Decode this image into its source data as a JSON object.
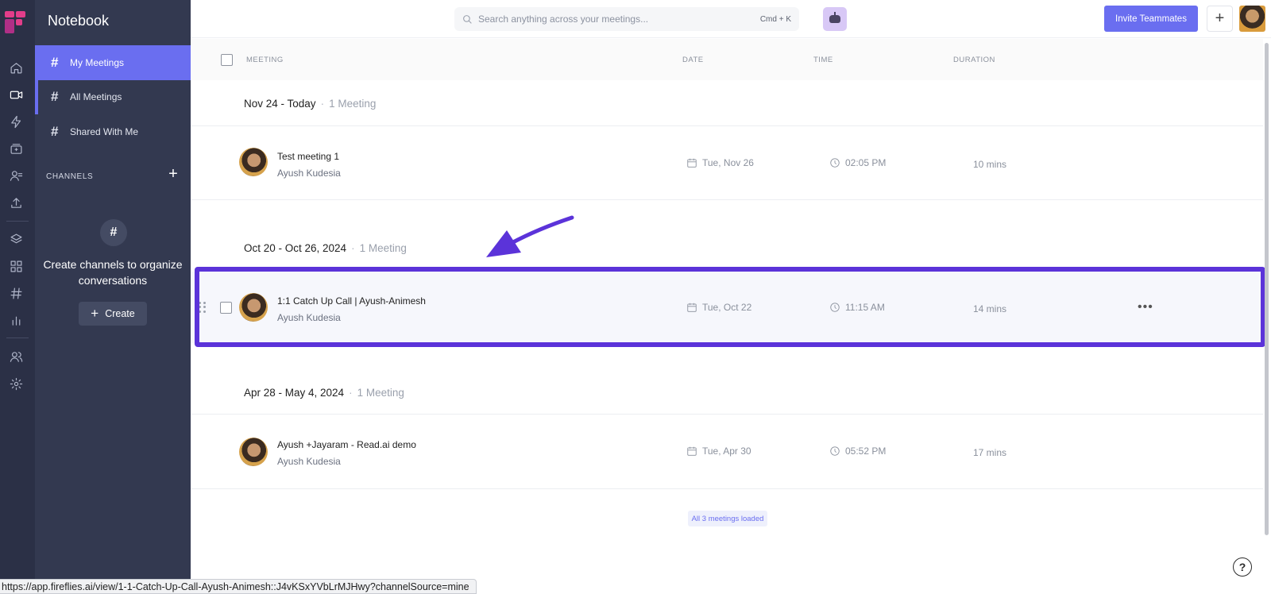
{
  "app": {
    "name": "Notebook",
    "brand_color": "#6a6ef0",
    "rail_icons": [
      "home-icon",
      "video-icon",
      "bolt-icon",
      "inbox-icon",
      "contacts-icon",
      "upload-icon",
      "layers-icon",
      "apps-grid-icon",
      "hash-icon",
      "analytics-icon",
      "team-icon",
      "settings-icon"
    ]
  },
  "sidebar": {
    "items": [
      {
        "label": "My Meetings"
      },
      {
        "label": "All Meetings"
      },
      {
        "label": "Shared With Me"
      }
    ],
    "channels_label": "CHANNELS",
    "channels_empty_text": "Create channels to organize conversations",
    "create_label": "Create"
  },
  "topbar": {
    "search_placeholder": "Search anything across your meetings...",
    "shortcut": "Cmd + K",
    "invite_label": "Invite Teammates"
  },
  "table": {
    "columns": [
      "MEETING",
      "DATE",
      "TIME",
      "DURATION"
    ],
    "groups": [
      {
        "range": "Nov 24 - Today",
        "count": "1 Meeting",
        "meetings": [
          {
            "title": "Test meeting 1",
            "owner": "Ayush Kudesia",
            "date": "Tue, Nov 26",
            "time": "02:05 PM",
            "duration": "10 mins"
          }
        ]
      },
      {
        "range": "Oct 20 - Oct 26, 2024",
        "count": "1 Meeting",
        "meetings": [
          {
            "title": "1:1 Catch Up Call | Ayush-Animesh",
            "owner": "Ayush Kudesia",
            "date": "Tue, Oct 22",
            "time": "11:15 AM",
            "duration": "14 mins"
          }
        ]
      },
      {
        "range": "Apr 28 - May 4, 2024",
        "count": "1 Meeting",
        "meetings": [
          {
            "title": "Ayush +Jayaram - Read.ai demo",
            "owner": "Ayush Kudesia",
            "date": "Tue, Apr 30",
            "time": "05:52 PM",
            "duration": "17 mins"
          }
        ]
      }
    ],
    "footer": "All 3 meetings loaded"
  },
  "annotation": {
    "highlight_color": "#5b33d9"
  },
  "status_bar_url": "https://app.fireflies.ai/view/1-1-Catch-Up-Call-Ayush-Animesh::J4vKSxYVbLrMJHwy?channelSource=mine"
}
